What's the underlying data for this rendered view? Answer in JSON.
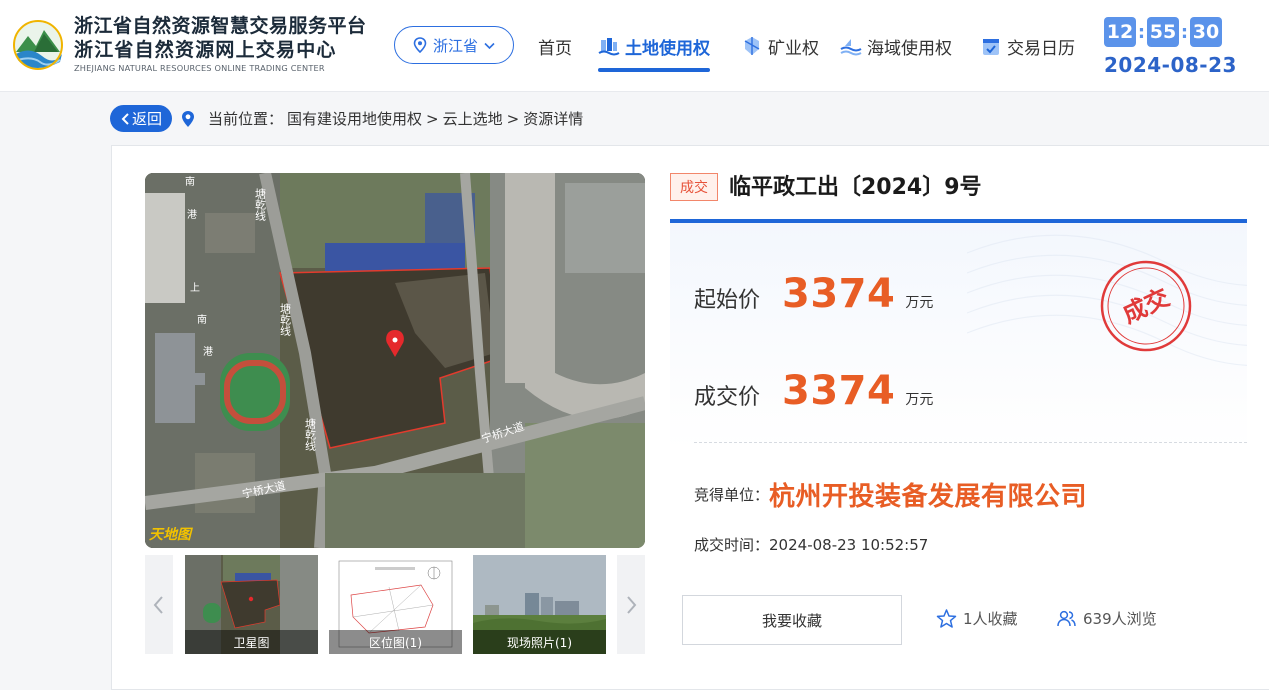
{
  "brand": {
    "title_line1": "浙江省自然资源智慧交易服务平台",
    "title_line2": "浙江省自然资源网上交易中心",
    "title_en": "ZHEJIANG NATURAL RESOURCES ONLINE TRADING CENTER"
  },
  "region": {
    "label": "浙江省"
  },
  "nav": [
    {
      "label": "首页",
      "icon": "none"
    },
    {
      "label": "土地使用权",
      "icon": "land-icon",
      "active": true
    },
    {
      "label": "矿业权",
      "icon": "mining-icon"
    },
    {
      "label": "海域使用权",
      "icon": "sea-icon"
    },
    {
      "label": "交易日历",
      "icon": "calendar-icon"
    }
  ],
  "clock": {
    "hh": "12",
    "mm": "55",
    "ss": "30",
    "date": "2024-08-23"
  },
  "breadcrumb": {
    "back": "返回",
    "prefix": "当前位置：",
    "items": [
      "国有建设用地使用权",
      "云上选地",
      "资源详情"
    ],
    "sep": ">"
  },
  "listing": {
    "status_tag": "成交",
    "title": "临平政工出〔2024〕9号",
    "start_price_label": "起始价",
    "start_price": "3374",
    "deal_price_label": "成交价",
    "deal_price": "3374",
    "unit": "万元",
    "stamp": "成交",
    "winner_label": "竞得单位：",
    "winner": "杭州开投装备发展有限公司",
    "deal_time_label": "成交时间：",
    "deal_time": "2024-08-23 10:52:57",
    "favorite_button": "我要收藏",
    "favorites": "1人收藏",
    "views": "639人浏览"
  },
  "map": {
    "road_labels": [
      "塘乾线",
      "塘乾线",
      "塘乾线",
      "宁桥大道",
      "宁桥大道",
      "南",
      "港",
      "上",
      "南",
      "港"
    ],
    "watermark": "天地图"
  },
  "thumbnails": [
    {
      "caption": "卫星图"
    },
    {
      "caption": "区位图(1)"
    },
    {
      "caption": "现场照片(1)"
    }
  ],
  "colors": {
    "primary": "#1e66d8",
    "price": "#e85d25",
    "stamp": "#e03a3a"
  }
}
